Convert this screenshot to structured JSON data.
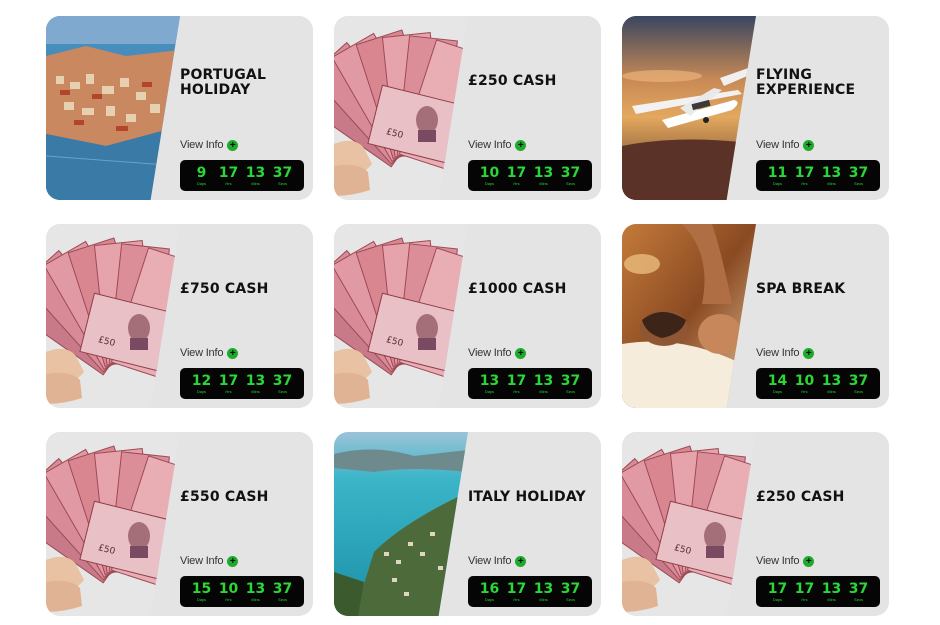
{
  "timer_labels": {
    "days": "Days",
    "hrs": "Hrs",
    "mins": "Mins",
    "secs": "Secs"
  },
  "view_info_label": "View Info",
  "cards": [
    {
      "title": "PORTUGAL HOLIDAY",
      "image": "portugal-photo",
      "timer": {
        "days": "9",
        "hrs": "17",
        "mins": "13",
        "secs": "37"
      }
    },
    {
      "title": "£250 CASH",
      "image": "cash-photo",
      "timer": {
        "days": "10",
        "hrs": "17",
        "mins": "13",
        "secs": "37"
      }
    },
    {
      "title": "FLYING EXPERIENCE",
      "image": "plane-photo",
      "timer": {
        "days": "11",
        "hrs": "17",
        "mins": "13",
        "secs": "37"
      }
    },
    {
      "title": "£750 CASH",
      "image": "cash-photo",
      "timer": {
        "days": "12",
        "hrs": "17",
        "mins": "13",
        "secs": "37"
      }
    },
    {
      "title": "£1000 CASH",
      "image": "cash-photo",
      "timer": {
        "days": "13",
        "hrs": "17",
        "mins": "13",
        "secs": "37"
      }
    },
    {
      "title": "SPA BREAK",
      "image": "spa-photo",
      "timer": {
        "days": "14",
        "hrs": "10",
        "mins": "13",
        "secs": "37"
      }
    },
    {
      "title": "£550 CASH",
      "image": "cash-photo",
      "timer": {
        "days": "15",
        "hrs": "10",
        "mins": "13",
        "secs": "37"
      }
    },
    {
      "title": "ITALY HOLIDAY",
      "image": "italy-photo",
      "timer": {
        "days": "16",
        "hrs": "17",
        "mins": "13",
        "secs": "37"
      }
    },
    {
      "title": "£250 CASH",
      "image": "cash-photo",
      "timer": {
        "days": "17",
        "hrs": "17",
        "mins": "13",
        "secs": "37"
      }
    }
  ],
  "colors": {
    "card_bg": "#e4e4e4",
    "timer_bg": "#050505",
    "timer_digit": "#2bd636",
    "plus_badge": "#1faa2c"
  }
}
